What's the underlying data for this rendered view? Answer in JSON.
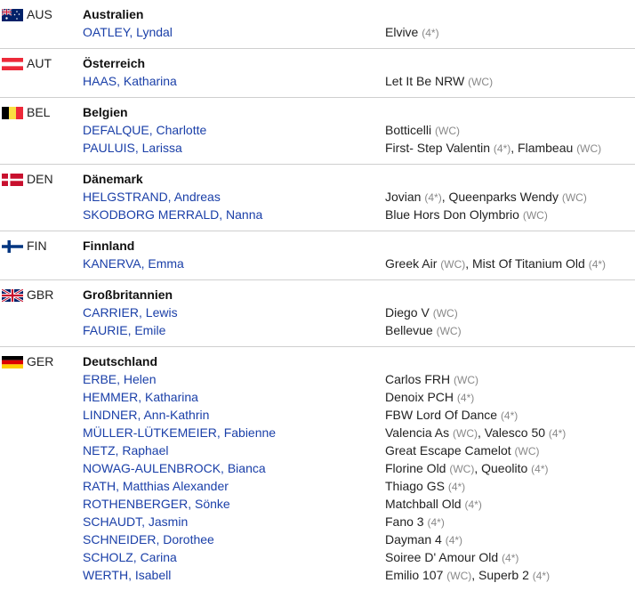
{
  "groups": [
    {
      "code": "AUS",
      "flag": "aus",
      "country": "Australien",
      "entries": [
        {
          "rider": "OATLEY, Lyndal",
          "horses": [
            {
              "name": "Elvive",
              "level": "(4*)"
            }
          ]
        }
      ]
    },
    {
      "code": "AUT",
      "flag": "aut",
      "country": "Österreich",
      "entries": [
        {
          "rider": "HAAS, Katharina",
          "horses": [
            {
              "name": "Let It Be NRW",
              "level": "(WC)"
            }
          ]
        }
      ]
    },
    {
      "code": "BEL",
      "flag": "bel",
      "country": "Belgien",
      "entries": [
        {
          "rider": "DEFALQUE, Charlotte",
          "horses": [
            {
              "name": "Botticelli",
              "level": "(WC)"
            }
          ]
        },
        {
          "rider": "PAULUIS, Larissa",
          "horses": [
            {
              "name": "First- Step Valentin",
              "level": "(4*)"
            },
            {
              "name": "Flambeau",
              "level": "(WC)"
            }
          ]
        }
      ]
    },
    {
      "code": "DEN",
      "flag": "den",
      "country": "Dänemark",
      "entries": [
        {
          "rider": "HELGSTRAND, Andreas",
          "horses": [
            {
              "name": "Jovian",
              "level": "(4*)"
            },
            {
              "name": "Queenparks Wendy",
              "level": "(WC)"
            }
          ]
        },
        {
          "rider": "SKODBORG MERRALD, Nanna",
          "horses": [
            {
              "name": "Blue Hors Don Olymbrio",
              "level": "(WC)"
            }
          ]
        }
      ]
    },
    {
      "code": "FIN",
      "flag": "fin",
      "country": "Finnland",
      "entries": [
        {
          "rider": "KANERVA, Emma",
          "horses": [
            {
              "name": "Greek Air",
              "level": "(WC)"
            },
            {
              "name": "Mist Of Titanium Old",
              "level": "(4*)"
            }
          ]
        }
      ]
    },
    {
      "code": "GBR",
      "flag": "gbr",
      "country": "Großbritannien",
      "entries": [
        {
          "rider": "CARRIER, Lewis",
          "horses": [
            {
              "name": "Diego V",
              "level": "(WC)"
            }
          ]
        },
        {
          "rider": "FAURIE, Emile",
          "horses": [
            {
              "name": "Bellevue",
              "level": "(WC)"
            }
          ]
        }
      ]
    },
    {
      "code": "GER",
      "flag": "ger",
      "country": "Deutschland",
      "entries": [
        {
          "rider": "ERBE, Helen",
          "horses": [
            {
              "name": "Carlos FRH",
              "level": "(WC)"
            }
          ]
        },
        {
          "rider": "HEMMER, Katharina",
          "horses": [
            {
              "name": "Denoix PCH",
              "level": "(4*)"
            }
          ]
        },
        {
          "rider": "LINDNER, Ann-Kathrin",
          "horses": [
            {
              "name": "FBW Lord Of Dance",
              "level": "(4*)"
            }
          ]
        },
        {
          "rider": "MÜLLER-LÜTKEMEIER, Fabienne",
          "horses": [
            {
              "name": "Valencia As",
              "level": "(WC)"
            },
            {
              "name": "Valesco 50",
              "level": "(4*)"
            }
          ]
        },
        {
          "rider": "NETZ, Raphael",
          "horses": [
            {
              "name": "Great Escape Camelot",
              "level": "(WC)"
            }
          ]
        },
        {
          "rider": "NOWAG-AULENBROCK, Bianca",
          "horses": [
            {
              "name": "Florine Old",
              "level": "(WC)"
            },
            {
              "name": "Queolito",
              "level": "(4*)"
            }
          ]
        },
        {
          "rider": "RATH, Matthias Alexander",
          "horses": [
            {
              "name": "Thiago GS",
              "level": "(4*)"
            }
          ]
        },
        {
          "rider": "ROTHENBERGER, Sönke",
          "horses": [
            {
              "name": "Matchball Old",
              "level": "(4*)"
            }
          ]
        },
        {
          "rider": "SCHAUDT, Jasmin",
          "horses": [
            {
              "name": "Fano 3",
              "level": "(4*)"
            }
          ]
        },
        {
          "rider": "SCHNEIDER, Dorothee",
          "horses": [
            {
              "name": "Dayman 4",
              "level": "(4*)"
            }
          ]
        },
        {
          "rider": "SCHOLZ, Carina",
          "horses": [
            {
              "name": "Soiree D' Amour Old",
              "level": "(4*)"
            }
          ]
        },
        {
          "rider": "WERTH, Isabell",
          "horses": [
            {
              "name": "Emilio 107",
              "level": "(WC)"
            },
            {
              "name": "Superb 2",
              "level": "(4*)"
            }
          ]
        }
      ]
    }
  ]
}
